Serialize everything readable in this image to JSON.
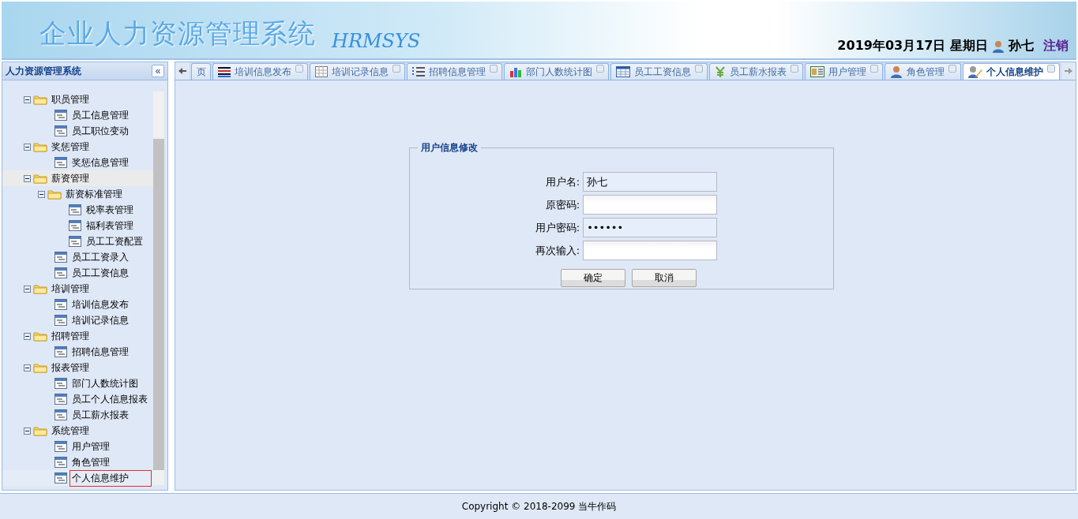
{
  "header": {
    "title": "企业人力资源管理系统",
    "logo_text": "HRMSYS",
    "date": "2019年03月17日 星期日",
    "user": "孙七",
    "logout": "注销"
  },
  "sidebar": {
    "title": "人力资源管理系统",
    "collapse": "«",
    "tree": [
      {
        "label": "职员管理",
        "expanded": true,
        "highlighted": false,
        "selected": false,
        "children": [
          {
            "label": "员工信息管理",
            "highlighted": false,
            "selected": false
          },
          {
            "label": "员工职位变动",
            "highlighted": false,
            "selected": false
          }
        ]
      },
      {
        "label": "奖惩管理",
        "expanded": true,
        "highlighted": false,
        "selected": false,
        "children": [
          {
            "label": "奖惩信息管理",
            "highlighted": false,
            "selected": false
          }
        ]
      },
      {
        "label": "薪资管理",
        "expanded": true,
        "highlighted": true,
        "selected": false,
        "children": [
          {
            "label": "薪资标准管理",
            "expanded": true,
            "highlighted": false,
            "selected": false,
            "children": [
              {
                "label": "税率表管理",
                "highlighted": false,
                "selected": false
              },
              {
                "label": "福利表管理",
                "highlighted": false,
                "selected": false
              },
              {
                "label": "员工工资配置",
                "highlighted": false,
                "selected": false
              }
            ]
          },
          {
            "label": "员工工资录入",
            "highlighted": false,
            "selected": false
          },
          {
            "label": "员工工资信息",
            "highlighted": false,
            "selected": false
          }
        ]
      },
      {
        "label": "培训管理",
        "expanded": true,
        "highlighted": false,
        "selected": false,
        "children": [
          {
            "label": "培训信息发布",
            "highlighted": false,
            "selected": false
          },
          {
            "label": "培训记录信息",
            "highlighted": false,
            "selected": false
          }
        ]
      },
      {
        "label": "招聘管理",
        "expanded": true,
        "highlighted": false,
        "selected": false,
        "children": [
          {
            "label": "招聘信息管理",
            "highlighted": false,
            "selected": false
          }
        ]
      },
      {
        "label": "报表管理",
        "expanded": true,
        "highlighted": false,
        "selected": false,
        "children": [
          {
            "label": "部门人数统计图",
            "highlighted": false,
            "selected": false
          },
          {
            "label": "员工个人信息报表",
            "highlighted": false,
            "selected": false
          },
          {
            "label": "员工薪水报表",
            "highlighted": false,
            "selected": false
          }
        ]
      },
      {
        "label": "系统管理",
        "expanded": true,
        "highlighted": false,
        "selected": false,
        "children": [
          {
            "label": "用户管理",
            "highlighted": false,
            "selected": false
          },
          {
            "label": "角色管理",
            "highlighted": false,
            "selected": false
          },
          {
            "label": "个人信息维护",
            "highlighted": false,
            "selected": true
          }
        ]
      }
    ]
  },
  "tabs": [
    {
      "label": "页",
      "closable": false,
      "selected": false
    },
    {
      "label": "培训信息发布",
      "closable": true,
      "selected": false
    },
    {
      "label": "培训记录信息",
      "closable": true,
      "selected": false
    },
    {
      "label": "招聘信息管理",
      "closable": true,
      "selected": false
    },
    {
      "label": "部门人数统计图",
      "closable": true,
      "selected": false
    },
    {
      "label": "员工工资信息",
      "closable": true,
      "selected": false
    },
    {
      "label": "员工薪水报表",
      "closable": true,
      "selected": false
    },
    {
      "label": "用户管理",
      "closable": true,
      "selected": false
    },
    {
      "label": "角色管理",
      "closable": true,
      "selected": false
    },
    {
      "label": "个人信息维护",
      "closable": true,
      "selected": true
    }
  ],
  "form": {
    "legend": "用户信息修改",
    "fields": [
      {
        "label": "用户名:",
        "value": "孙七",
        "readonly": true
      },
      {
        "label": "原密码:",
        "readonly": false
      },
      {
        "label": "用户密码:",
        "value": "••••••",
        "readonly": true
      },
      {
        "label": "再次输入:",
        "readonly": false
      }
    ],
    "buttons": [
      "确定",
      "取消"
    ]
  },
  "footer": "Copyright © 2018-2099 当牛作码"
}
